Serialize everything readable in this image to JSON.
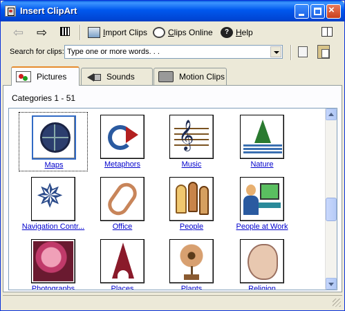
{
  "window": {
    "title": "Insert ClipArt"
  },
  "toolbar": {
    "import_prefix": "",
    "import_underline": "I",
    "import_rest": "mport Clips",
    "online_prefix": "",
    "online_underline": "C",
    "online_rest": "lips Online",
    "help_prefix": "",
    "help_underline": "H",
    "help_rest": "elp",
    "icons": [
      "back-arrow-icon",
      "forward-arrow-icon",
      "all-categories-icon",
      "import-clips-icon",
      "clips-online-icon",
      "help-icon",
      "change-pane-icon"
    ]
  },
  "search": {
    "label": "Search for clips:",
    "placeholder": "Type one or more words. . .",
    "value": "Type one or more words. . ."
  },
  "tabs": [
    {
      "label": "Pictures",
      "active": true
    },
    {
      "label": "Sounds",
      "active": false
    },
    {
      "label": "Motion Clips",
      "active": false
    }
  ],
  "panel": {
    "categories_label": "Categories 1 - 51"
  },
  "categories": [
    {
      "name": "Maps",
      "icon": "globe-icon",
      "selected": true
    },
    {
      "name": "Metaphors",
      "icon": "metaphor-icon",
      "selected": false
    },
    {
      "name": "Music",
      "icon": "music-icon",
      "selected": false
    },
    {
      "name": "Nature",
      "icon": "nature-icon",
      "selected": false
    },
    {
      "name": "Navigation Contr...",
      "icon": "compass-star-icon",
      "selected": false
    },
    {
      "name": "Office",
      "icon": "paperclip-icon",
      "selected": false
    },
    {
      "name": "People",
      "icon": "people-icon",
      "selected": false
    },
    {
      "name": "People at Work",
      "icon": "people-at-work-icon",
      "selected": false
    },
    {
      "name": "Photographs",
      "icon": "photograph-icon",
      "selected": false
    },
    {
      "name": "Places",
      "icon": "eiffel-tower-icon",
      "selected": false
    },
    {
      "name": "Plants",
      "icon": "flower-icon",
      "selected": false
    },
    {
      "name": "Religion",
      "icon": "religion-icon",
      "selected": false
    }
  ],
  "scrollbar": {
    "position_fraction": 0.5
  },
  "colors": {
    "title_bar": "#0058ee",
    "link": "#0000cc",
    "active_tab_accent": "#e68b2c"
  }
}
